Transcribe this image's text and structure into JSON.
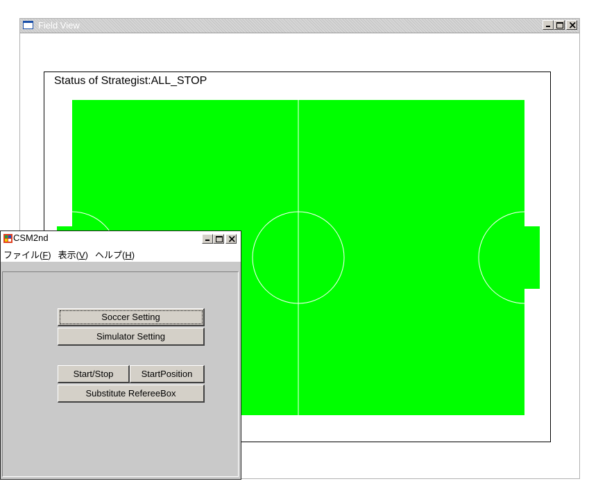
{
  "field_window": {
    "title": "Field View",
    "status_label": "Status of Strategist:ALL_STOP"
  },
  "app_window": {
    "title": "CSM2nd",
    "menu": [
      {
        "label": "ファイル(",
        "accel": "F",
        "tail": ")"
      },
      {
        "label": "表示(",
        "accel": "V",
        "tail": ")"
      },
      {
        "label": "ヘルプ(",
        "accel": "H",
        "tail": ")"
      }
    ],
    "buttons": {
      "soccer_setting": "Soccer Setting",
      "simulator_setting": "Simulator Setting",
      "start_stop": "Start/Stop",
      "start_position": "StartPosition",
      "substitute_refereebox": "Substitute RefereeBox"
    }
  },
  "colors": {
    "pitch": "#00ff00",
    "lines": "#ffffff",
    "title_text": "#ffffff"
  }
}
